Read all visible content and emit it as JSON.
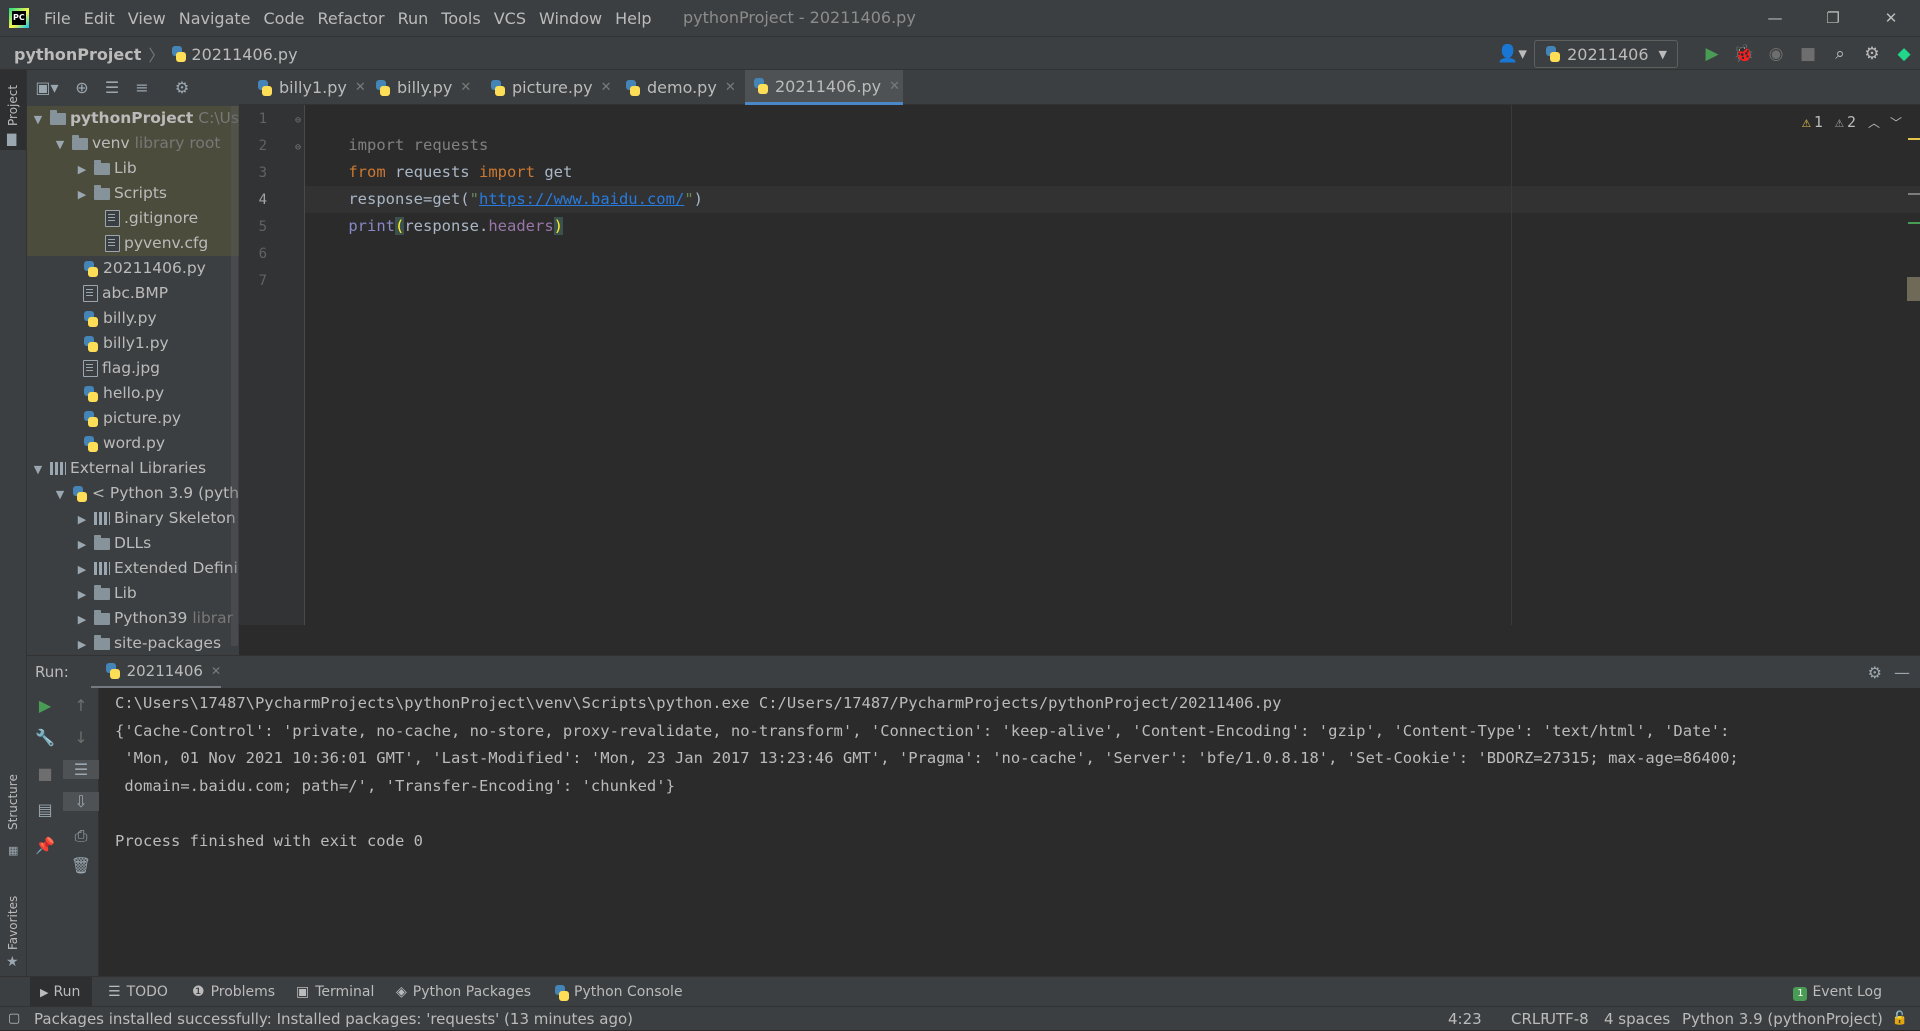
{
  "menu": [
    "File",
    "Edit",
    "View",
    "Navigate",
    "Code",
    "Refactor",
    "Run",
    "Tools",
    "VCS",
    "Window",
    "Help"
  ],
  "window_title": "pythonProject - 20211406.py",
  "breadcrumb": {
    "project": "pythonProject",
    "file": "20211406.py"
  },
  "run_config": "20211406",
  "tabs": [
    {
      "label": "billy1.py",
      "active": false
    },
    {
      "label": "billy.py",
      "active": false
    },
    {
      "label": "picture.py",
      "active": false
    },
    {
      "label": "demo.py",
      "active": false
    },
    {
      "label": "20211406.py",
      "active": true
    }
  ],
  "left_stripe": {
    "project": "Project",
    "structure": "Structure",
    "favorites": "Favorites"
  },
  "tree": {
    "root": {
      "label": "pythonProject",
      "hint": "C:\\Us"
    },
    "venv": {
      "label": "venv",
      "hint": "library root"
    },
    "lib": "Lib",
    "scripts": "Scripts",
    "gitignore": ".gitignore",
    "pyvenv": "pyvenv.cfg",
    "files": [
      "20211406.py",
      "abc.BMP",
      "billy.py",
      "billy1.py",
      "flag.jpg",
      "hello.py",
      "picture.py",
      "word.py"
    ],
    "external": "External Libraries",
    "python39": "< Python 3.9 (pyth",
    "binary": "Binary Skeleton",
    "dlls": "DLLs",
    "extended": "Extended Defini",
    "lib2": "Lib",
    "py39dir": {
      "label": "Python39",
      "hint": "librar"
    },
    "site": "site-packages"
  },
  "line_numbers": [
    "1",
    "2",
    "3",
    "4",
    "5",
    "6",
    "7"
  ],
  "code": {
    "l1": {
      "kw": "import",
      "rest": " requests"
    },
    "l2": {
      "kw1": "from",
      "mid": " requests ",
      "kw2": "import",
      "rest": " get"
    },
    "l3": {
      "pre": "response=get(",
      "q1": "\"",
      "url": "https://www.baidu.com/",
      "q2": "\"",
      "post": ")"
    },
    "l4": {
      "fn": "print",
      "open": "(",
      "obj": "response.",
      "attr": "headers",
      "close": ")"
    }
  },
  "inspections": {
    "warnings": "1",
    "weak": "2"
  },
  "run": {
    "label": "Run:",
    "tab": "20211406",
    "console": [
      "C:\\Users\\17487\\PycharmProjects\\pythonProject\\venv\\Scripts\\python.exe C:/Users/17487/PycharmProjects/pythonProject/20211406.py",
      "{'Cache-Control': 'private, no-cache, no-store, proxy-revalidate, no-transform', 'Connection': 'keep-alive', 'Content-Encoding': 'gzip', 'Content-Type': 'text/html', 'Date':",
      " 'Mon, 01 Nov 2021 10:36:01 GMT', 'Last-Modified': 'Mon, 23 Jan 2017 13:23:46 GMT', 'Pragma': 'no-cache', 'Server': 'bfe/1.0.8.18', 'Set-Cookie': 'BDORZ=27315; max-age=86400;",
      " domain=.baidu.com; path=/', 'Transfer-Encoding': 'chunked'}",
      "",
      "Process finished with exit code 0"
    ]
  },
  "bottom_tools": [
    "Run",
    "TODO",
    "Problems",
    "Terminal",
    "Python Packages",
    "Python Console"
  ],
  "event_log": {
    "count": "1",
    "label": "Event Log"
  },
  "status": {
    "message": "Packages installed successfully: Installed packages: 'requests' (13 minutes ago)",
    "position": "4:23",
    "line_sep": "CRLF",
    "encoding": "UTF-8",
    "indent": "4 spaces",
    "interpreter": "Python 3.9 (pythonProject)"
  },
  "colors": {
    "accent": "#4a88c7",
    "keyword": "#cc7832",
    "string": "#6a8759",
    "link": "#287bde",
    "warning": "#e6c44b"
  }
}
